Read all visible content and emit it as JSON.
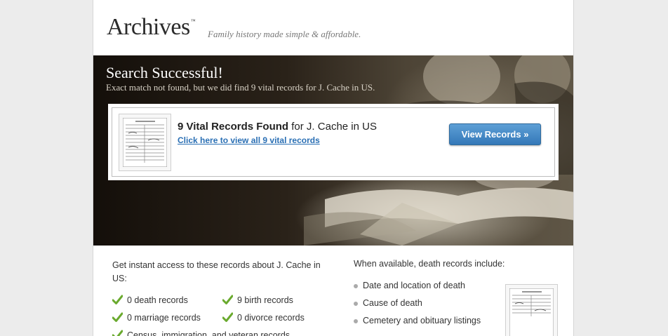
{
  "header": {
    "logo": "Archives",
    "trademark": "™",
    "tagline": "Family history made simple & affordable."
  },
  "hero": {
    "title": "Search Successful!",
    "subtitle": "Exact match not found, but we did find 9 vital records for J. Cache in US."
  },
  "result": {
    "count_label": "9 Vital Records Found",
    "for_text": " for J. Cache in US",
    "link": "Click here to view all 9 vital records",
    "button": "View Records »"
  },
  "records": {
    "intro": "Get instant access to these records about J. Cache in US:",
    "items": [
      "0 death records",
      "9 birth records",
      "0 marriage records",
      "0 divorce records",
      "Census, immigration, and veteran records"
    ]
  },
  "death_info": {
    "heading": "When available, death records include:",
    "items": [
      "Date and location of death",
      "Cause of death",
      "Cemetery and obituary listings"
    ]
  },
  "colors": {
    "button": "#3d82c2",
    "link": "#2a6fb4",
    "check": "#6aaa2e"
  }
}
